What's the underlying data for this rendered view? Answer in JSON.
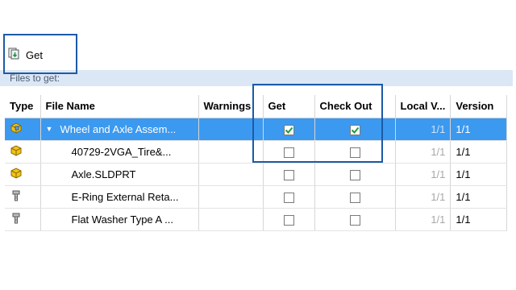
{
  "toolbar": {
    "get_label": "Get"
  },
  "files_to_get_label": "Files to get:",
  "columns": [
    "Type",
    "File Name",
    "Warnings",
    "Get",
    "Check Out",
    "Local V...",
    "Version"
  ],
  "rows": [
    {
      "icon": "assembly-icon",
      "name": "Wheel and Axle Assem...",
      "warnings": "",
      "get": true,
      "checkout": true,
      "local": "1/1",
      "version": "1/1",
      "expanded": true,
      "selected": true
    },
    {
      "icon": "part-icon",
      "name": "40729-2VGA_Tire&...",
      "warnings": "",
      "get": false,
      "checkout": false,
      "local": "1/1",
      "version": "1/1"
    },
    {
      "icon": "part-icon",
      "name": "Axle.SLDPRT",
      "warnings": "",
      "get": false,
      "checkout": false,
      "local": "1/1",
      "version": "1/1"
    },
    {
      "icon": "toolbox-part-icon",
      "name": "E-Ring External Reta...",
      "warnings": "",
      "get": false,
      "checkout": false,
      "local": "1/1",
      "version": "1/1"
    },
    {
      "icon": "toolbox-part-icon",
      "name": "Flat Washer Type A ...",
      "warnings": "",
      "get": false,
      "checkout": false,
      "local": "1/1",
      "version": "1/1"
    }
  ],
  "colors": {
    "selected_row": "#3c99f0",
    "highlight_border": "#1c5aa8",
    "files_bar": "#dce7f5",
    "check_green": "#1e9a3a"
  }
}
